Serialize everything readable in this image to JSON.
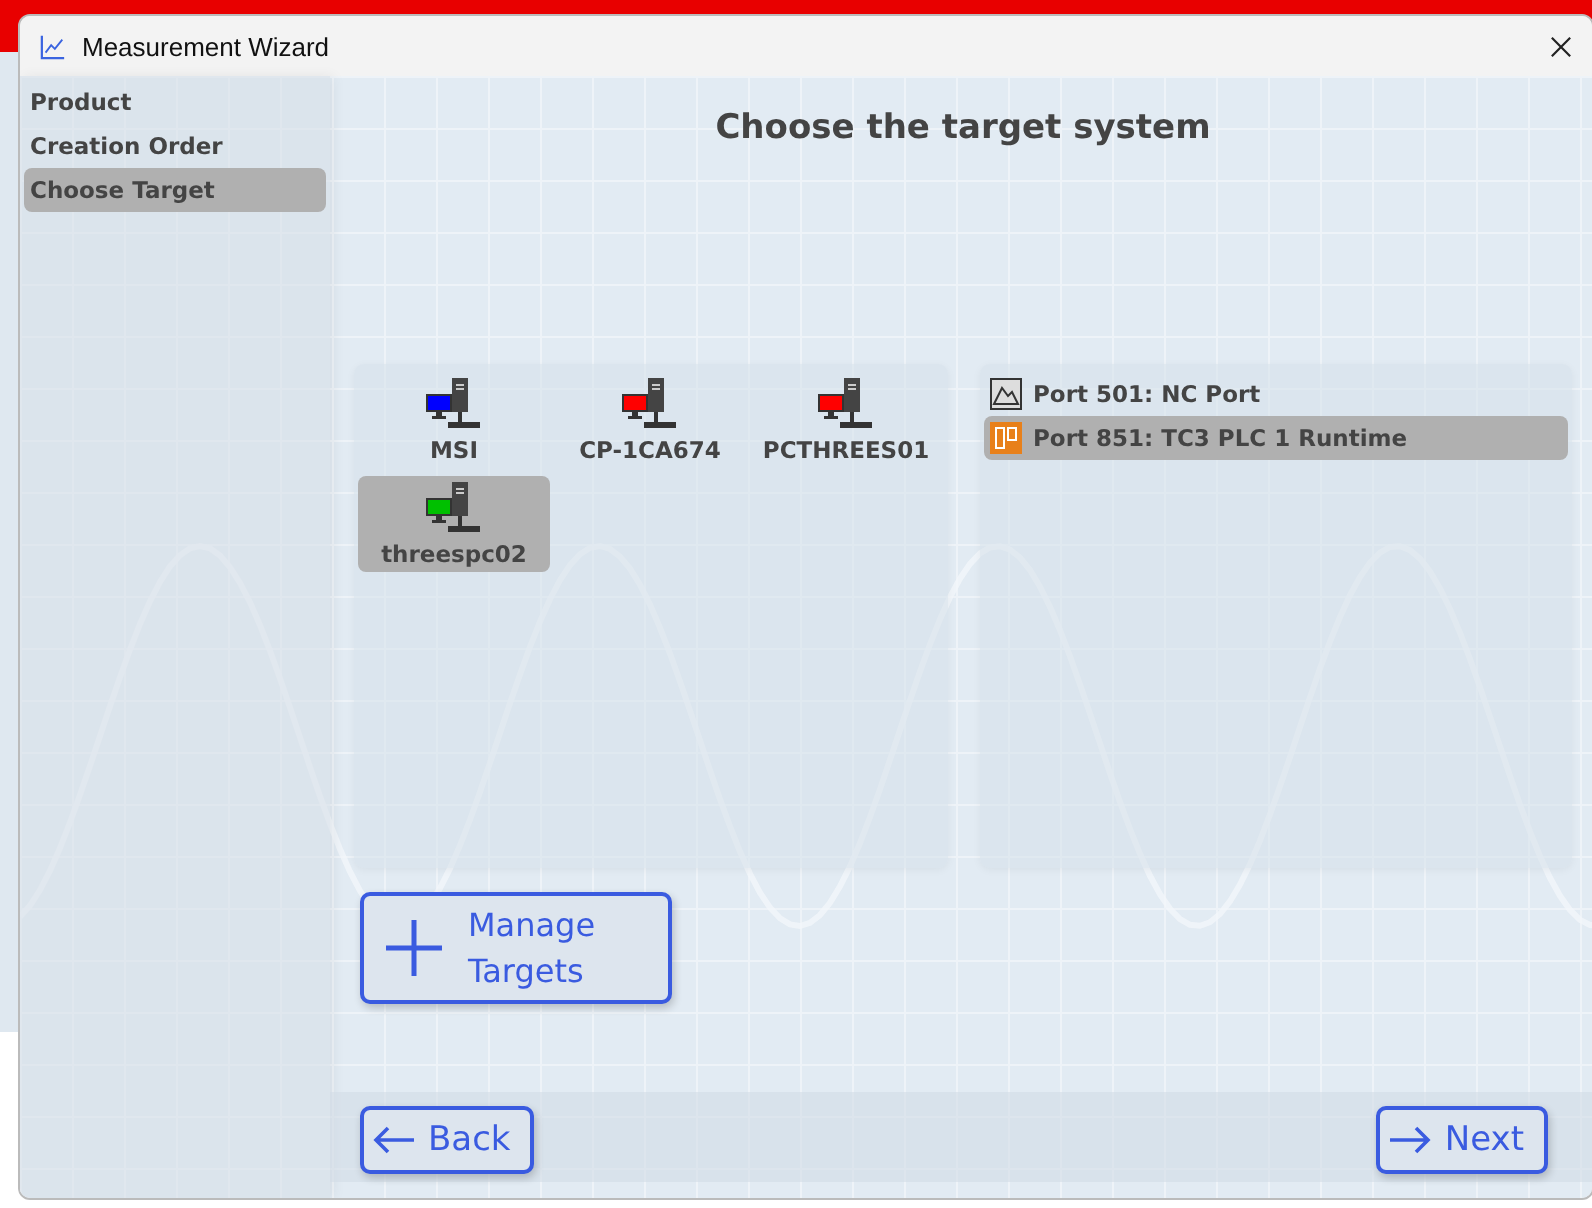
{
  "window": {
    "title": "Measurement Wizard"
  },
  "steps": [
    {
      "label": "Product",
      "selected": false
    },
    {
      "label": "Creation Order",
      "selected": false
    },
    {
      "label": "Choose Target",
      "selected": true
    }
  ],
  "heading": "Choose the target system",
  "targets": [
    {
      "name": "MSI",
      "color": "#0000ff",
      "selected": false
    },
    {
      "name": "CP-1CA674",
      "color": "#ff0000",
      "selected": false
    },
    {
      "name": "PCTHREES01",
      "color": "#ff0000",
      "selected": false
    },
    {
      "name": "threespc02",
      "color": "#00c000",
      "selected": true
    }
  ],
  "ports": [
    {
      "label": "Port 501: NC Port",
      "kind": "nc",
      "selected": false
    },
    {
      "label": "Port 851: TC3 PLC 1 Runtime",
      "kind": "plc",
      "selected": true
    }
  ],
  "manage_button": {
    "label": "Manage Targets"
  },
  "back_button": {
    "label": "Back"
  },
  "next_button": {
    "label": "Next"
  }
}
